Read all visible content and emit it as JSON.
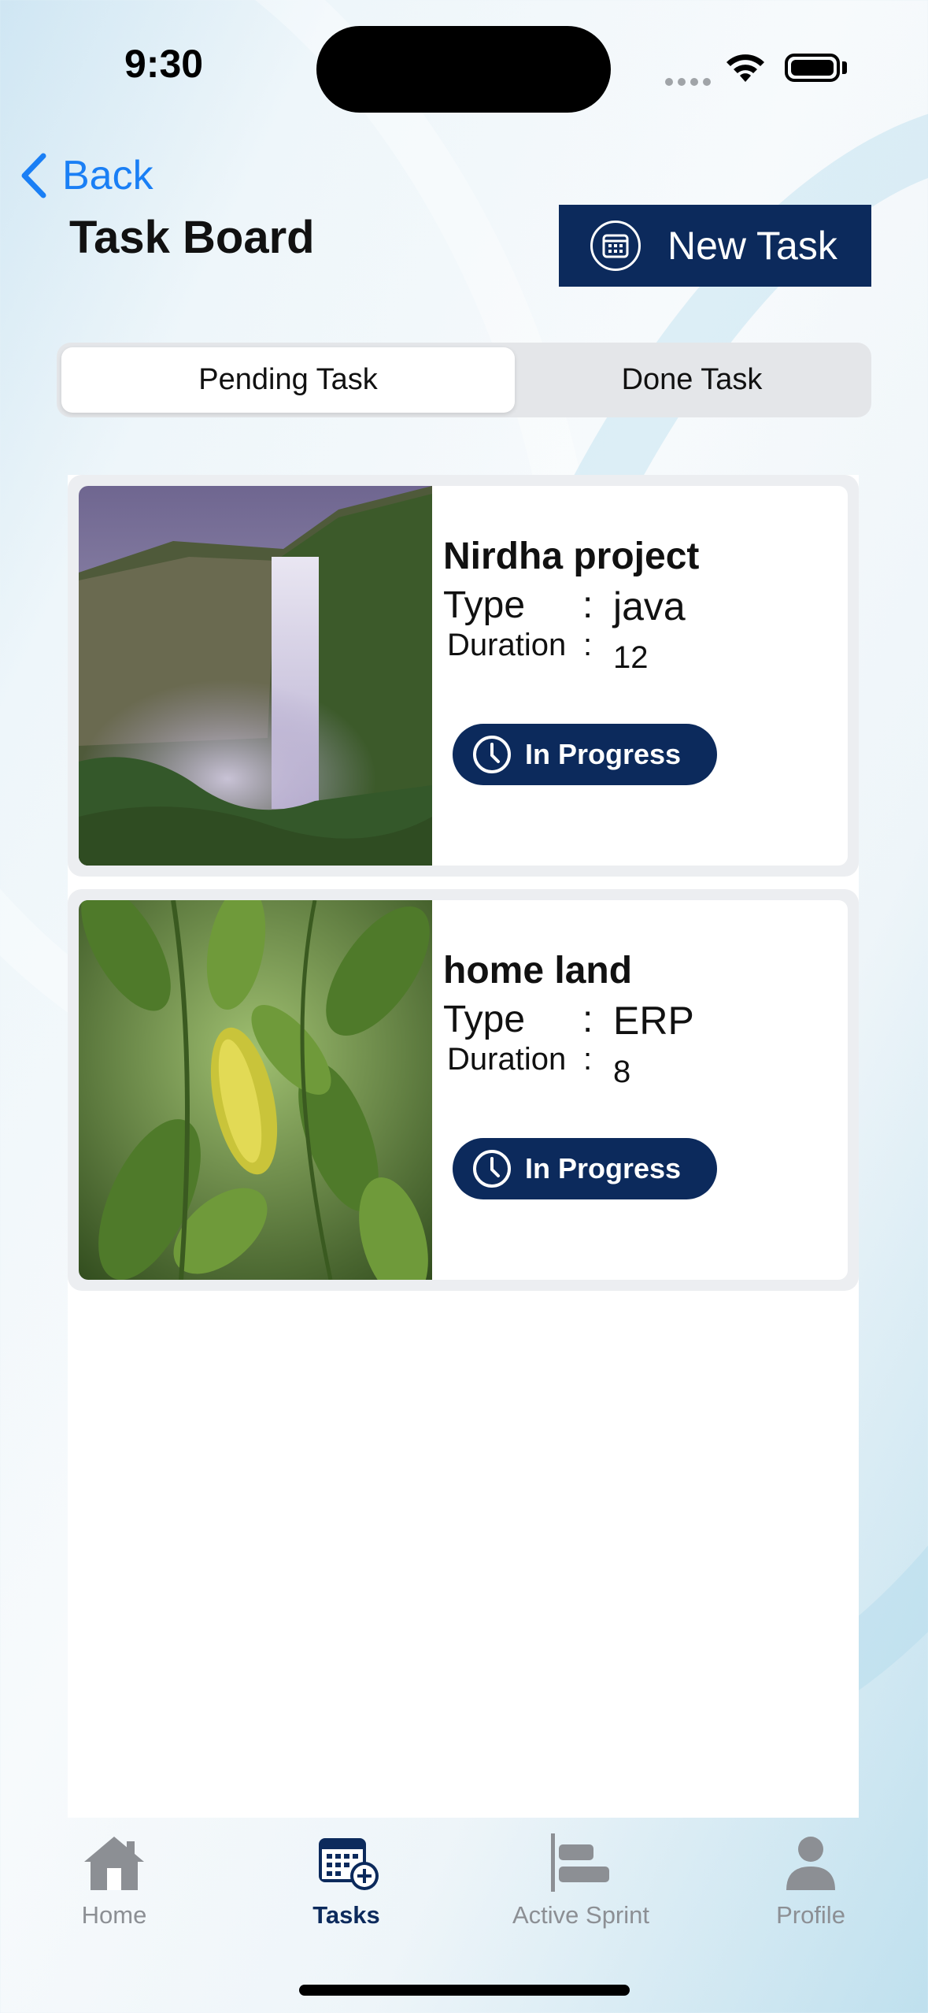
{
  "status": {
    "time": "9:30"
  },
  "nav": {
    "back_label": "Back",
    "title": "Task Board",
    "new_task_label": "New Task"
  },
  "segments": {
    "pending": "Pending Task",
    "done": "Done Task",
    "selected": "Pending Task"
  },
  "tasks": [
    {
      "title": "Nirdha project",
      "type_label": "Type",
      "type_value": "java",
      "duration_label": "Duration",
      "duration_value": "12",
      "status": "In Progress",
      "image": "waterfall"
    },
    {
      "title": "home land",
      "type_label": "Type",
      "type_value": "ERP",
      "duration_label": "Duration",
      "duration_value": "8",
      "status": "In Progress",
      "image": "green-leaves"
    }
  ],
  "tabbar": {
    "items": [
      {
        "label": "Home",
        "icon": "home-icon",
        "active": false
      },
      {
        "label": "Tasks",
        "icon": "tasks-calendar-icon",
        "active": true
      },
      {
        "label": "Active Sprint",
        "icon": "sprint-bars-icon",
        "active": false
      },
      {
        "label": "Profile",
        "icon": "person-icon",
        "active": false
      }
    ]
  },
  "colors": {
    "accent": "#0c2a5c",
    "link": "#1a7ff5",
    "inactive_tab": "#8c8f94"
  }
}
